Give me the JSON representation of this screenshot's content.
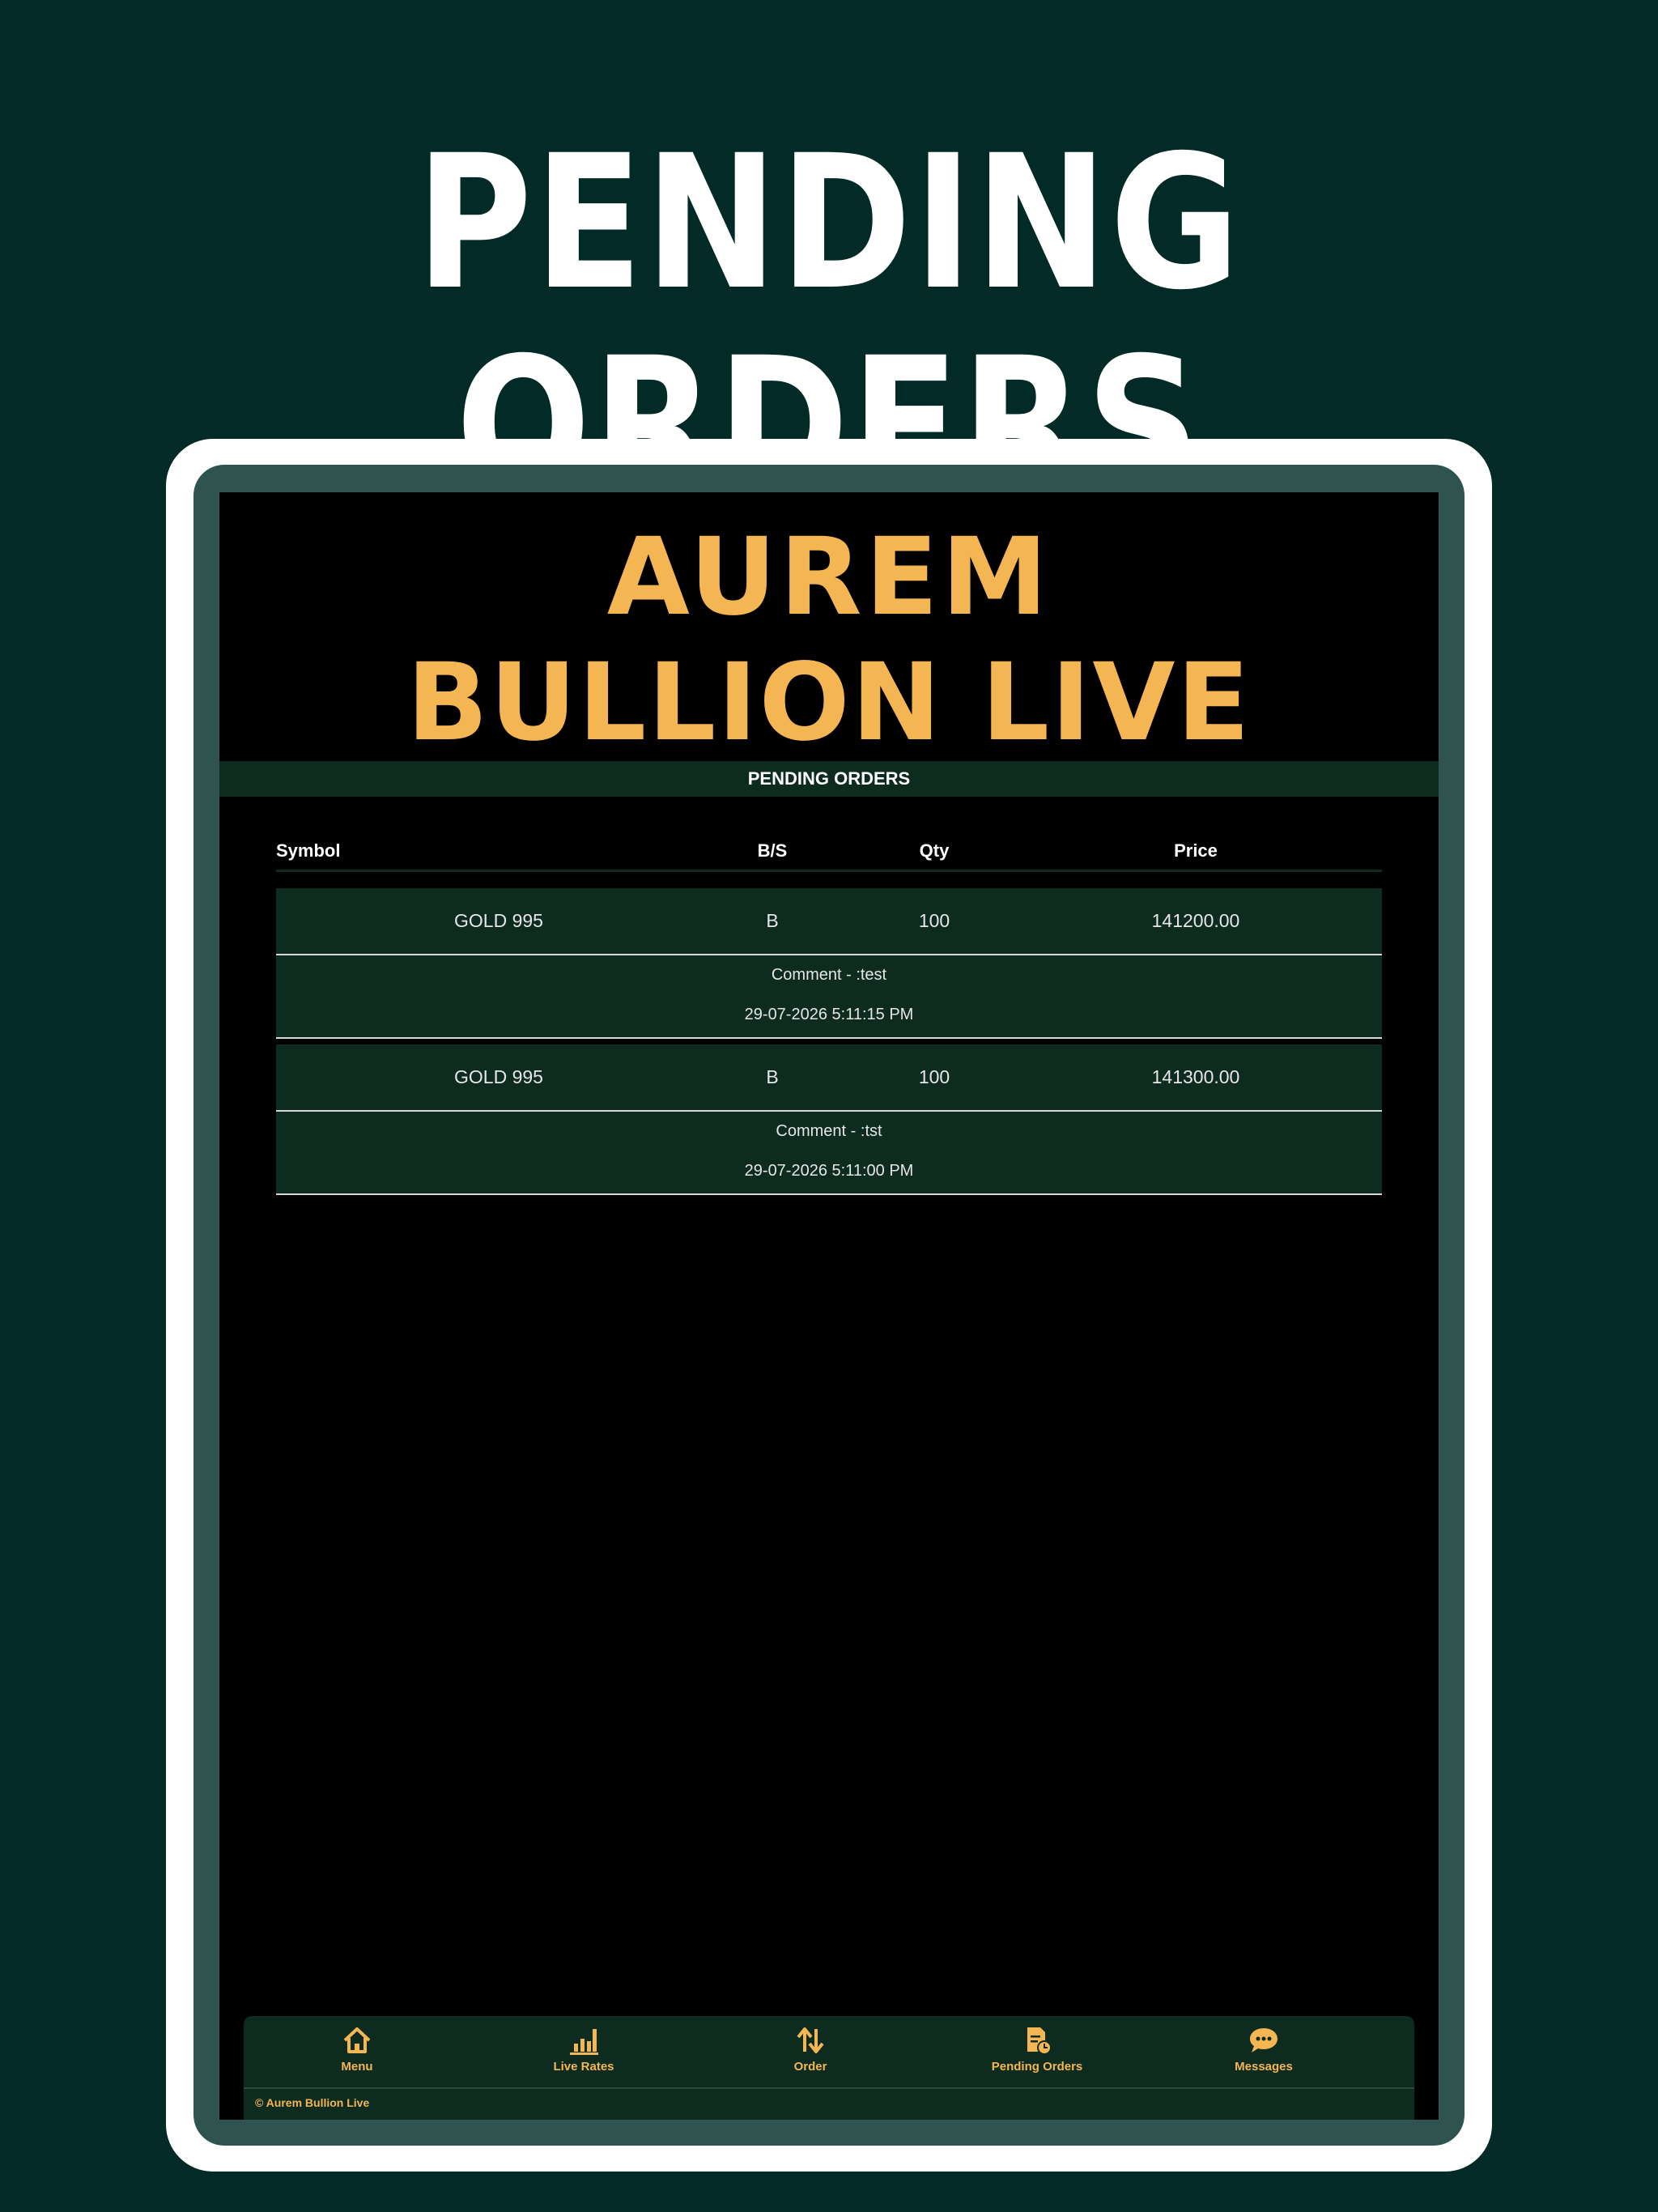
{
  "headline": "PENDING ORDERS",
  "colors": {
    "background": "#022b28",
    "gold": "#f4b553",
    "panel": "#0e2b1f",
    "bezel": "#2f5450"
  },
  "logo": {
    "line1": "AUREM",
    "line2": "BULLION LIVE"
  },
  "page_title": "PENDING ORDERS",
  "table": {
    "headers": {
      "symbol": "Symbol",
      "bs": "B/S",
      "qty": "Qty",
      "price": "Price"
    },
    "orders": [
      {
        "symbol": "GOLD 995",
        "bs": "B",
        "qty": "100",
        "price": "141200.00",
        "comment": "Comment - :test",
        "time": "29-07-2026 5:11:15 PM"
      },
      {
        "symbol": "GOLD 995",
        "bs": "B",
        "qty": "100",
        "price": "141300.00",
        "comment": "Comment - :tst",
        "time": "29-07-2026 5:11:00 PM"
      }
    ]
  },
  "nav": {
    "items": [
      {
        "label": "Menu",
        "icon": "home-icon"
      },
      {
        "label": "Live Rates",
        "icon": "bar-chart-icon"
      },
      {
        "label": "Order",
        "icon": "up-down-arrows-icon"
      },
      {
        "label": "Pending Orders",
        "icon": "pending-document-icon"
      },
      {
        "label": "Messages",
        "icon": "chat-bubble-icon"
      }
    ],
    "active": "Pending Orders"
  },
  "footer": "© Aurem Bullion Live"
}
